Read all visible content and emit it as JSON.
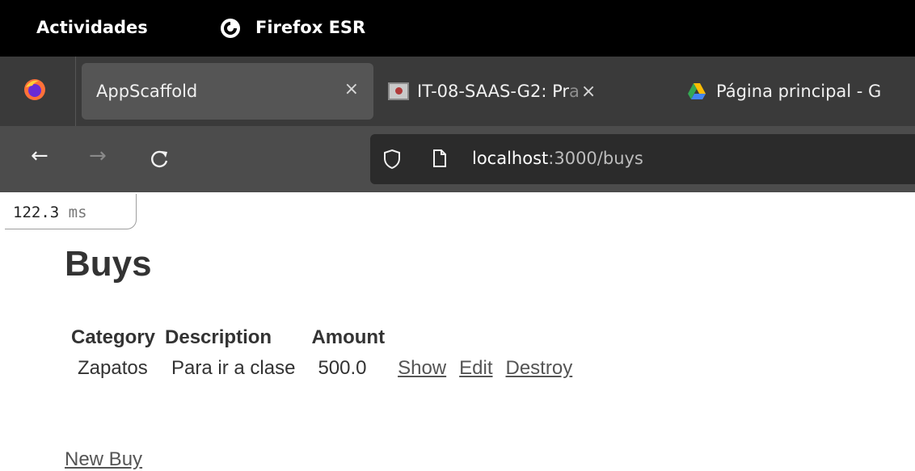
{
  "topbar": {
    "activities": "Actividades",
    "app_name": "Firefox ESR",
    "app_icon": "firefox-logo-icon"
  },
  "tabs": [
    {
      "title": "AppScaffold",
      "active": true,
      "close": "×"
    },
    {
      "title": "IT-08-SAAS-G2: Pr",
      "title_fade": "a",
      "close": "×",
      "favicon": "page-favicon-icon"
    },
    {
      "title": "Página principal - G",
      "favicon": "google-drive-icon"
    }
  ],
  "nav": {
    "back": "←",
    "forward": "→",
    "reload": "C",
    "url_host": "localhost",
    "url_rest": ":3000/buys"
  },
  "perf": {
    "value": "122.3",
    "unit": "ms"
  },
  "page": {
    "title": "Buys",
    "columns": [
      "Category",
      "Description",
      "Amount"
    ],
    "rows": [
      {
        "category": "Zapatos",
        "description": "Para ir a clase",
        "amount": "500.0",
        "show": "Show",
        "edit": "Edit",
        "destroy": "Destroy"
      }
    ],
    "new_link": "New Buy"
  },
  "colors": {
    "topbar": "#000000",
    "tabstrip": "#3a3a3a",
    "navbar": "#4c4c4c",
    "urlbar": "#2b2b2b",
    "text": "#333333"
  }
}
